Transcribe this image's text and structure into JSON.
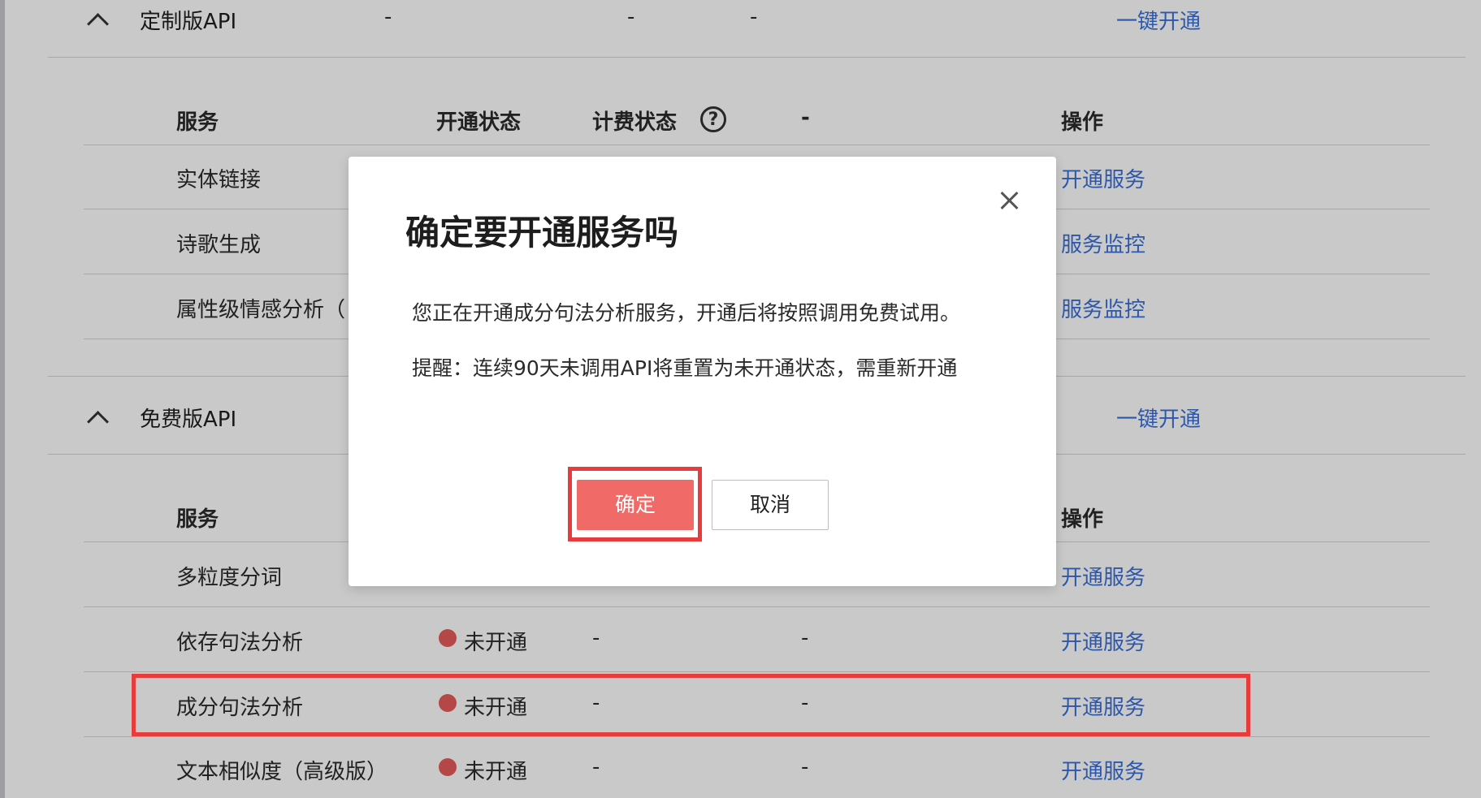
{
  "groups": [
    {
      "title": "定制版API",
      "header_dashes": [
        "-",
        "-",
        "-"
      ],
      "action": "一键开通",
      "columns": {
        "service": "服务",
        "status": "开通状态",
        "billing": "计费状态",
        "dash": "-",
        "action": "操作"
      },
      "help_icon": "?",
      "rows": [
        {
          "name": "实体链接",
          "action": "开通服务"
        },
        {
          "name": "诗歌生成",
          "action": "服务监控"
        },
        {
          "name": "属性级情感分析（",
          "action": "服务监控"
        }
      ]
    },
    {
      "title": "免费版API",
      "action": "一键开通",
      "columns": {
        "service": "服务",
        "action": "操作"
      },
      "rows": [
        {
          "name": "多粒度分词",
          "action": "开通服务"
        },
        {
          "name": "依存句法分析",
          "status": "未开通",
          "billing": "-",
          "dash": "-",
          "action": "开通服务"
        },
        {
          "name": "成分句法分析",
          "status": "未开通",
          "billing": "-",
          "dash": "-",
          "action": "开通服务"
        },
        {
          "name": "文本相似度（高级版）",
          "status": "未开通",
          "billing": "-",
          "dash": "-",
          "action": "开通服务"
        }
      ]
    }
  ],
  "dialog": {
    "title": "确定要开通服务吗",
    "message": "您正在开通成分句法分析服务，开通后将按照调用免费试用。",
    "reminder": "提醒：连续90天未调用API将重置为未开通状态，需重新开通",
    "confirm_label": "确定",
    "cancel_label": "取消"
  },
  "colors": {
    "link": "#3a6fd8",
    "status_dot": "#e65a5a",
    "confirm": "#f06b67",
    "highlight": "#e83b3b"
  }
}
